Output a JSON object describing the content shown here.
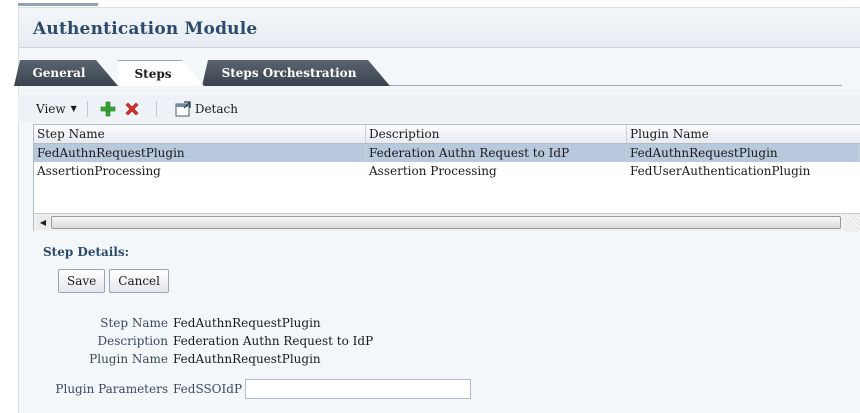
{
  "panel": {
    "title": "Authentication Module"
  },
  "tabs": [
    {
      "label": "General",
      "active": false
    },
    {
      "label": "Steps",
      "active": true
    },
    {
      "label": "Steps Orchestration",
      "active": false
    }
  ],
  "toolbar": {
    "view_label": "View",
    "add_icon": "plus-icon",
    "delete_icon": "x-icon",
    "detach_label": "Detach",
    "detach_icon": "detach-icon",
    "add_color": "#3aa335",
    "delete_color": "#d9322b"
  },
  "table": {
    "columns": [
      "Step Name",
      "Description",
      "Plugin Name"
    ],
    "rows": [
      {
        "step_name": "FedAuthnRequestPlugin",
        "description": "Federation Authn Request to IdP",
        "plugin_name": "FedAuthnRequestPlugin",
        "selected": true
      },
      {
        "step_name": "AssertionProcessing",
        "description": "Assertion Processing",
        "plugin_name": "FedUserAuthenticationPlugin",
        "selected": false
      }
    ]
  },
  "details": {
    "title": "Step Details:",
    "save_label": "Save",
    "cancel_label": "Cancel",
    "step_name_label": "Step Name",
    "step_name_value": "FedAuthnRequestPlugin",
    "description_label": "Description",
    "description_value": "Federation Authn Request to IdP",
    "plugin_name_label": "Plugin Name",
    "plugin_name_value": "FedAuthnRequestPlugin",
    "plugin_params_label": "Plugin Parameters",
    "param_name": "FedSSOIdP",
    "param_value": ""
  },
  "colors": {
    "title": "#2c4a6b",
    "selected_row": "#b8c8dd",
    "tab_dark": "#3a434d"
  }
}
